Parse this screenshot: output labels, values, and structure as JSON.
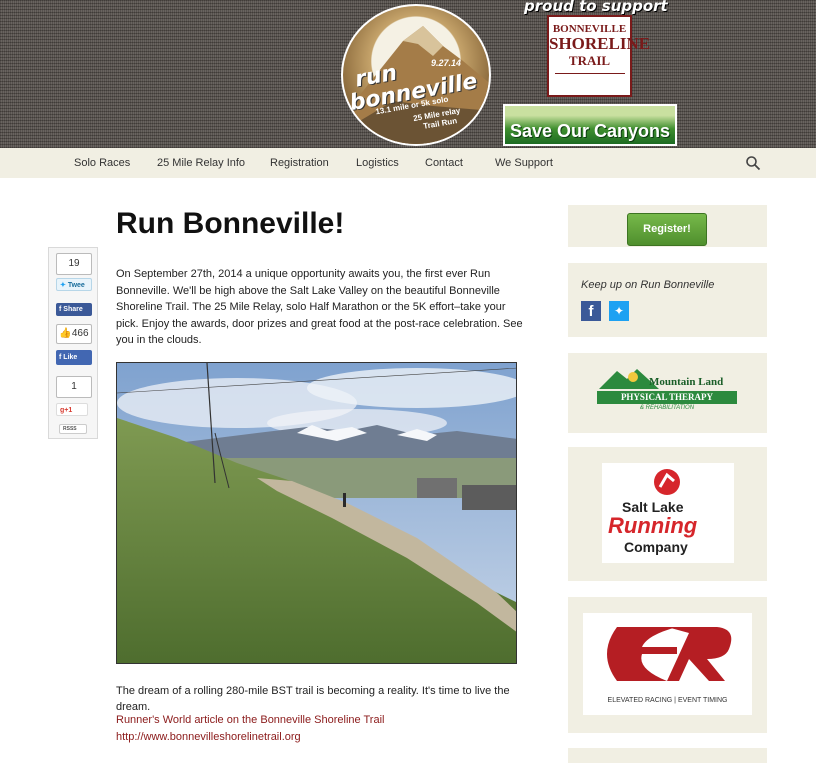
{
  "header": {
    "logo": {
      "date": "9.27.14",
      "run": "run",
      "name": "bonneville",
      "line1": "13.1 mile or 5k solo",
      "line2": "25 Mile relay",
      "line3": "Trail Run"
    },
    "proud_text": "proud to support",
    "bst": {
      "l1": "BONNEVILLE",
      "l2": "SHORELINE",
      "l3": "TRAIL"
    },
    "soc": "Save Our Canyons"
  },
  "nav": {
    "items": [
      "Solo Races",
      "25 Mile Relay Info",
      "Registration",
      "Logistics",
      "Contact",
      "We Support"
    ],
    "search_icon": "search-icon"
  },
  "share": {
    "tweet_count": "19",
    "tweet_label": "Twee",
    "fb_share_label": "Share",
    "like_count": "466",
    "like_label": "Like",
    "gplus_count": "1",
    "gplus_label": "+1",
    "rss_label": "RSSS"
  },
  "main": {
    "title": "Run Bonneville!",
    "intro": "On September 27th, 2014 a unique opportunity awaits you, the first ever Run Bonneville. We'll be high above the Salt Lake Valley on the beautiful Bonneville Shoreline Trail. The 25 Mile Relay, solo Half Marathon or the 5K effort–take your pick. Enjoy the awards, door prizes and great food at the post-race celebration. See you in the clouds.",
    "dream": "The dream of a rolling 280-mile BST trail is becoming a reality. It's time to live the dream.",
    "link1": "Runner's World article on the Bonneville Shoreline Trail",
    "link2": "http://www.bonnevilleshorelinetrail.org"
  },
  "sidebar": {
    "register_label": "Register!",
    "keep_up": "Keep up on Run Bonneville",
    "sponsors": {
      "mountain_land": {
        "name": "Mountain Land",
        "sub": "PHYSICAL THERAPY",
        "sub2": "& REHABILITATION"
      },
      "slrc": {
        "l1": "Salt Lake",
        "l2": "Running",
        "l3": "Company"
      },
      "er": {
        "caption": "ELEVATED RACING | EVENT TIMING"
      }
    }
  },
  "colors": {
    "nav_bg": "#f1efe3",
    "link": "#8b1a1a",
    "register_green": "#5a9a35",
    "facebook": "#3b5998",
    "twitter": "#1da1f2"
  }
}
